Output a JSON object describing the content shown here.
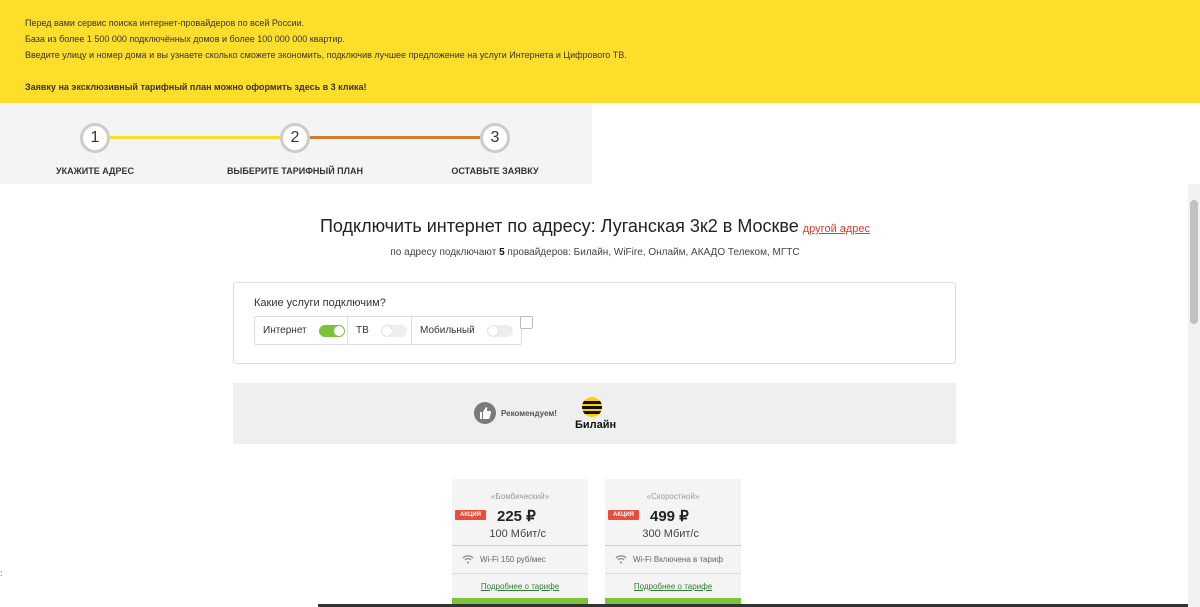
{
  "banner": {
    "lines": [
      "Перед вами сервис поиска интернет-провайдеров по всей России.",
      "База из более 1 500 000 подключённых домов и более 100 000 000 квартир.",
      "Введите улицу и номер дома и вы узнаете сколько сможете экономить, подключив лучшее предложение на услуги Интернета и Цифрового ТВ."
    ],
    "bold_line": "Заявку на эксклюзивный тарифный план можно оформить здесь в 3 клика!",
    "background": "#fdde2b"
  },
  "steps": [
    {
      "number": "1",
      "label": "УКАЖИТЕ АДРЕС"
    },
    {
      "number": "2",
      "label": "ВЫБЕРИТЕ ТАРИФНЫЙ ПЛАН"
    },
    {
      "number": "3",
      "label": "ОСТАВЬТЕ ЗАЯВКУ"
    }
  ],
  "step_colors": {
    "done": "#fdde2b",
    "active": "#d97a2b"
  },
  "headline": {
    "title": "Подключить интернет по адресу: Луганская 3к2 в Москве",
    "change_link": "другой адрес"
  },
  "subline": {
    "prefix": "по адресу подключают",
    "count": "5",
    "suffix": "провайдеров: Билайн, WiFire, Онлайм, АКАДО Телеком, МГТС"
  },
  "services": {
    "question": "Какие услуги подключим?",
    "items": [
      {
        "label": "Интернет",
        "on": true
      },
      {
        "label": "ТВ",
        "on": false
      },
      {
        "label": "Мобильный",
        "on": false
      }
    ]
  },
  "recommend": {
    "text": "Рекомендуем!",
    "provider": "Билайн"
  },
  "tariffs": [
    {
      "name": "«Бомбический»",
      "promo": "АКЦИЯ",
      "price": "225 ₽",
      "speed": "100 Мбит/с",
      "wifi": "Wi-Fi 150 руб/мес",
      "more": "Подробнее о тарифе"
    },
    {
      "name": "«Скоростной»",
      "promo": "АКЦИЯ",
      "price": "499 ₽",
      "speed": "300 Мбит/с",
      "wifi": "Wi-Fi Включена в тариф",
      "more": "Подробнее о тарифе"
    }
  ],
  "edge_mark": ":"
}
